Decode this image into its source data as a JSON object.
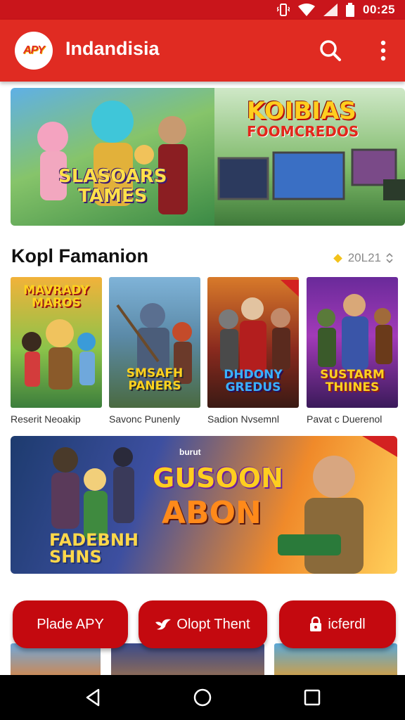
{
  "status_bar": {
    "time": "00:25",
    "icons": [
      "vibrate-icon",
      "wifi-icon",
      "signal-icon",
      "battery-icon"
    ]
  },
  "app_bar": {
    "logo_text": "APY",
    "title": "Indandisia",
    "actions": [
      "search-icon",
      "more-vert-icon"
    ]
  },
  "banner": {
    "title": "KOIBIAS",
    "subtitle": "FOOMCREDOS",
    "badge_line1": "SLASOARS",
    "badge_line2": "TAMES"
  },
  "section": {
    "title": "Kopl Famanion",
    "meta": "20L21"
  },
  "cards": [
    {
      "thumb_text": "MAVRADY MAROS",
      "caption": "Reserit Neoakip"
    },
    {
      "thumb_text": "SMSAFH PANERS",
      "caption": "Savonc Punenly"
    },
    {
      "thumb_text": "DHDONY GREDUS",
      "caption": "Sadion Nvsemnl"
    },
    {
      "thumb_text": "SUSTARM THIINES",
      "caption": "Pavat c Duerenol"
    }
  ],
  "feature": {
    "tag": "burut",
    "title": "GUSOON",
    "subtitle": "ABON",
    "badge_line1": "FADEBNH",
    "badge_line2": "SHNS"
  },
  "actions": [
    {
      "label": "Plade APY",
      "icon": "none"
    },
    {
      "label": "Olopt Thent",
      "icon": "bird-icon"
    },
    {
      "label": "icferdl",
      "icon": "lock-icon"
    }
  ],
  "colors": {
    "primary": "#e02b22",
    "status_bar": "#c9151b",
    "pill": "#c4090f"
  }
}
